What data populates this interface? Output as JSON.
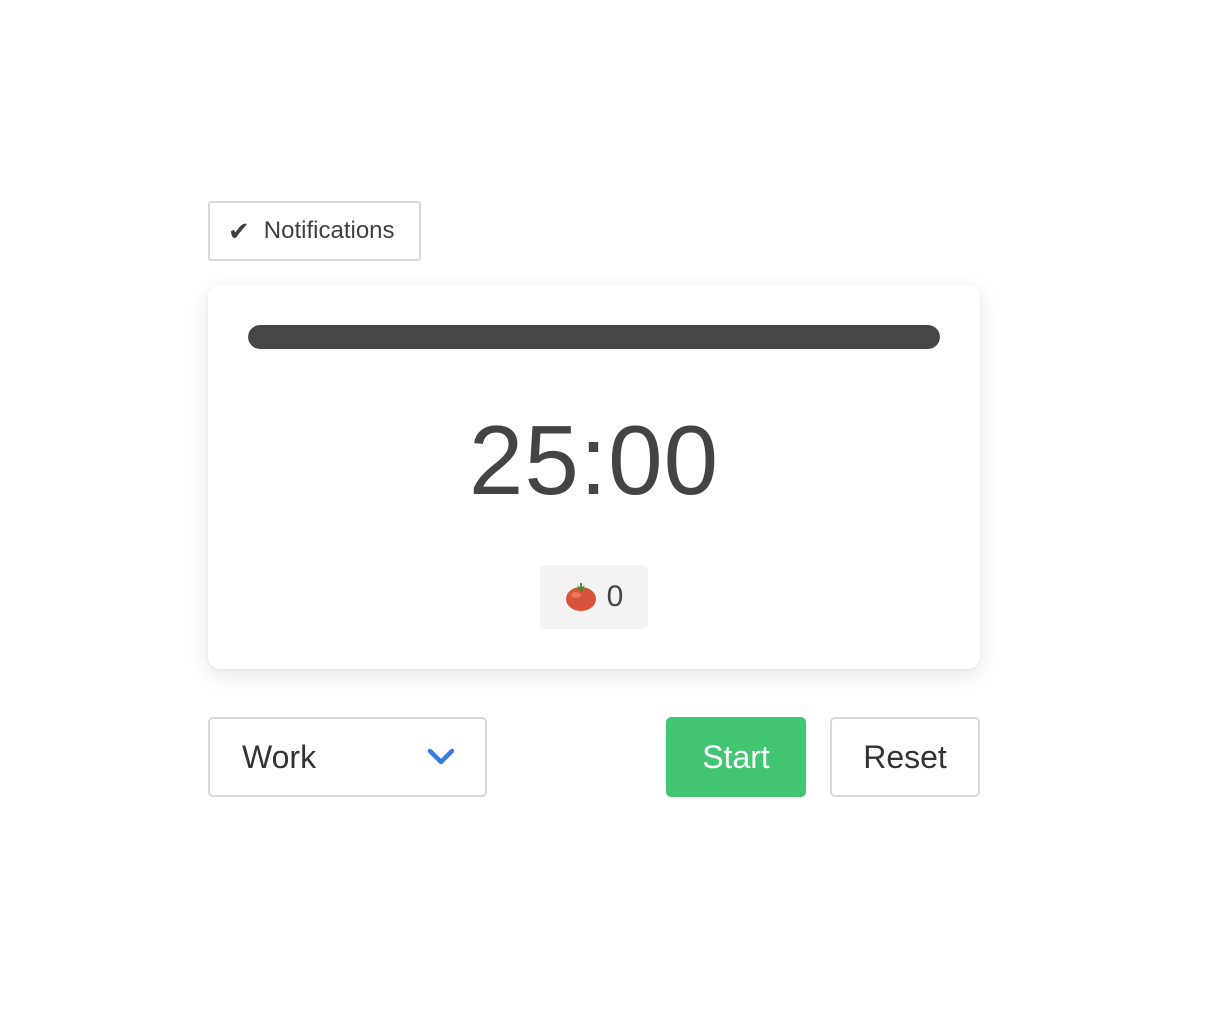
{
  "notifications": {
    "label": "Notifications",
    "checked": true,
    "check_glyph": "✔"
  },
  "timer": {
    "display": "25:00",
    "progress_fraction": 1.0,
    "progress_color": "#464646"
  },
  "pomodoro_count": {
    "icon": "tomato-icon",
    "value": "0"
  },
  "mode_select": {
    "selected": "Work",
    "chevron_color": "#3b7ddd"
  },
  "buttons": {
    "start_label": "Start",
    "start_color": "#43c673",
    "reset_label": "Reset"
  }
}
